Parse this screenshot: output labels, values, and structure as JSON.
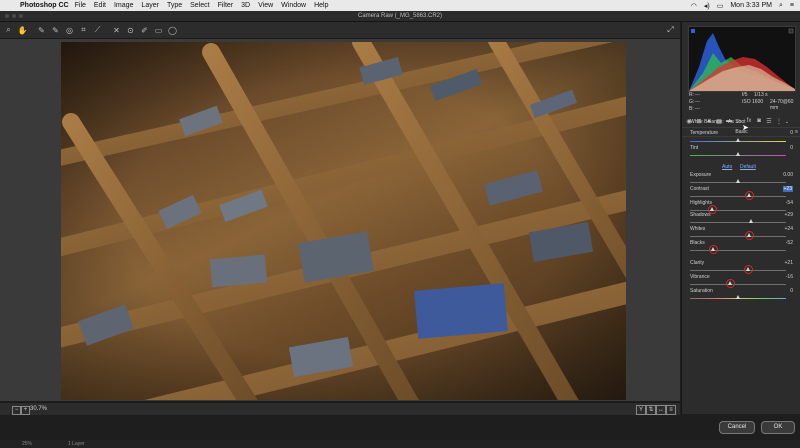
{
  "menubar": {
    "app_name": "Photoshop CC",
    "items": [
      "File",
      "Edit",
      "Image",
      "Layer",
      "Type",
      "Select",
      "Filter",
      "3D",
      "View",
      "Window",
      "Help"
    ],
    "clock": "Mon 3:33 PM"
  },
  "window": {
    "title": "Camera Raw (_MG_5863.CR2)"
  },
  "status": {
    "zoom": "30.7%"
  },
  "info": {
    "r_label": "R:",
    "g_label": "G:",
    "b_label": "B:",
    "dashes": "---",
    "aperture": "f/5",
    "shutter": "1/13 s",
    "iso": "ISO 1600",
    "lens": "24-70@60 mm"
  },
  "panel": {
    "section_title": "Basic",
    "white_balance_label": "White Balance:",
    "white_balance_value": "As Shot",
    "temperature_label": "Temperature",
    "temperature_value": "0",
    "tint_label": "Tint",
    "tint_value": "0",
    "auto_label": "Auto",
    "default_label": "Default",
    "sliders": [
      {
        "label": "Exposure",
        "value": "0.00",
        "pos": 0.5
      },
      {
        "label": "Contrast",
        "value": "+23",
        "pos": 0.615
      },
      {
        "label": "Highlights",
        "value": "-54",
        "pos": 0.23
      },
      {
        "label": "Shadows",
        "value": "+29",
        "pos": 0.645
      },
      {
        "label": "Whites",
        "value": "+24",
        "pos": 0.62
      },
      {
        "label": "Blacks",
        "value": "-52",
        "pos": 0.24
      },
      {
        "label": "Clarity",
        "value": "+21",
        "pos": 0.605
      },
      {
        "label": "Vibrance",
        "value": "-16",
        "pos": 0.42
      },
      {
        "label": "Saturation",
        "value": "0",
        "pos": 0.5
      }
    ]
  },
  "buttons": {
    "cancel": "Cancel",
    "ok": "OK"
  },
  "footer": {
    "zoom": "25%",
    "doc": "1 Layer"
  }
}
